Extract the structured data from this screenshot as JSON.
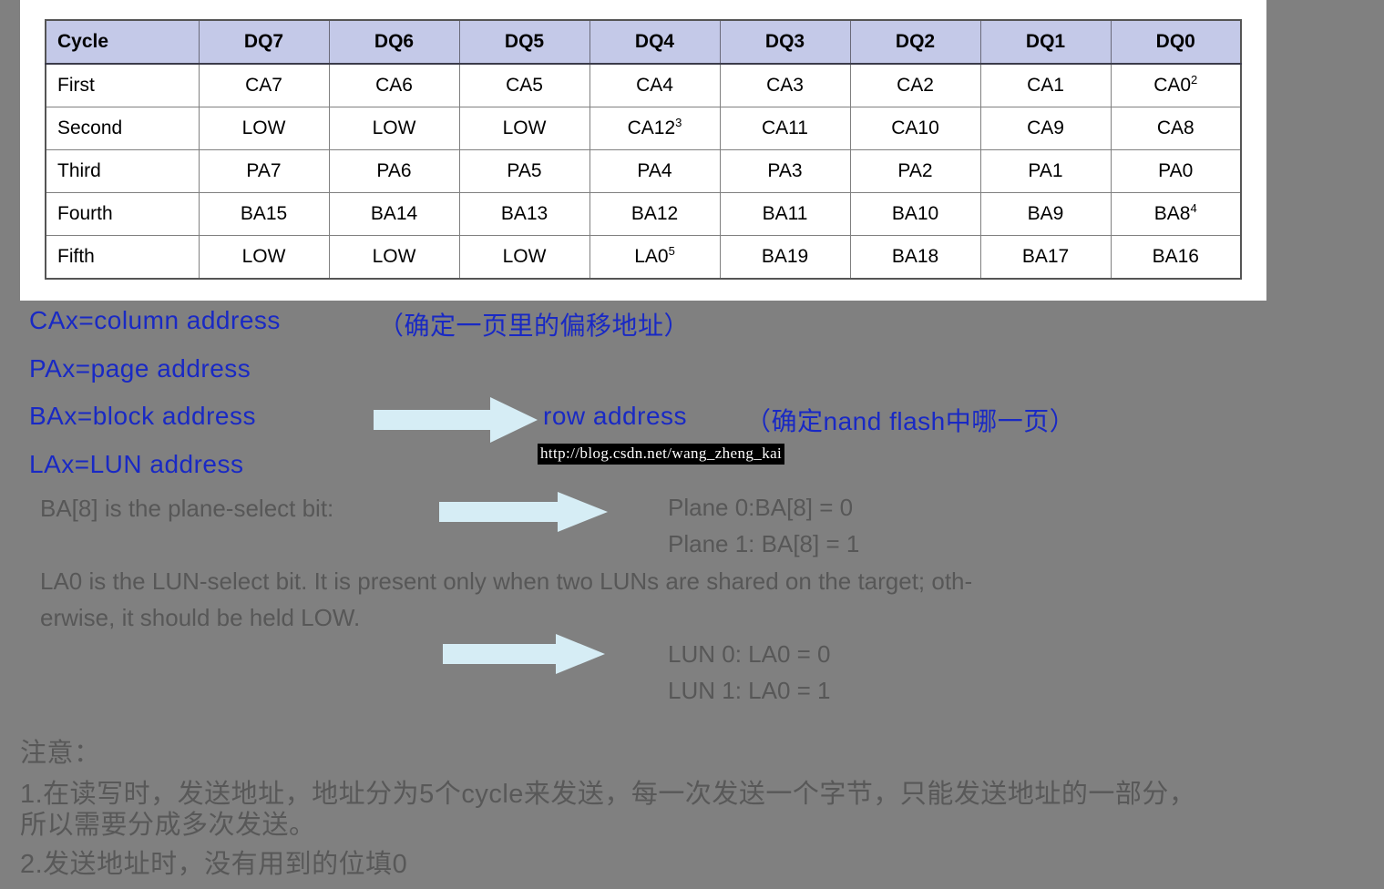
{
  "table": {
    "headers": [
      "Cycle",
      "DQ7",
      "DQ6",
      "DQ5",
      "DQ4",
      "DQ3",
      "DQ2",
      "DQ1",
      "DQ0"
    ],
    "rows": [
      {
        "cycle": "First",
        "cells": [
          {
            "text": "CA7"
          },
          {
            "text": "CA6"
          },
          {
            "text": "CA5"
          },
          {
            "text": "CA4"
          },
          {
            "text": "CA3"
          },
          {
            "text": "CA2"
          },
          {
            "text": "CA1"
          },
          {
            "text": "CA0",
            "sup": "2"
          }
        ]
      },
      {
        "cycle": "Second",
        "cells": [
          {
            "text": "LOW"
          },
          {
            "text": "LOW"
          },
          {
            "text": "LOW"
          },
          {
            "text": "CA12",
            "sup": "3"
          },
          {
            "text": "CA11"
          },
          {
            "text": "CA10"
          },
          {
            "text": "CA9"
          },
          {
            "text": "CA8"
          }
        ]
      },
      {
        "cycle": "Third",
        "cells": [
          {
            "text": "PA7"
          },
          {
            "text": "PA6"
          },
          {
            "text": "PA5"
          },
          {
            "text": "PA4"
          },
          {
            "text": "PA3"
          },
          {
            "text": "PA2"
          },
          {
            "text": "PA1"
          },
          {
            "text": "PA0"
          }
        ]
      },
      {
        "cycle": "Fourth",
        "cells": [
          {
            "text": "BA15"
          },
          {
            "text": "BA14"
          },
          {
            "text": "BA13"
          },
          {
            "text": "BA12"
          },
          {
            "text": "BA11"
          },
          {
            "text": "BA10"
          },
          {
            "text": "BA9"
          },
          {
            "text": "BA8",
            "sup": "4"
          }
        ]
      },
      {
        "cycle": "Fifth",
        "cells": [
          {
            "text": "LOW"
          },
          {
            "text": "LOW"
          },
          {
            "text": "LOW"
          },
          {
            "text": "LA0",
            "sup": "5"
          },
          {
            "text": "BA19"
          },
          {
            "text": "BA18"
          },
          {
            "text": "BA17"
          },
          {
            "text": "BA16"
          }
        ]
      }
    ]
  },
  "legend": {
    "column_address": "CAx=column address",
    "column_address_note": "（确定一页里的偏移地址）",
    "page_address": "PAx=page address",
    "block_address": "BAx=block address",
    "lun_address": "LAx=LUN address",
    "row_address": "row address",
    "row_address_note": "（确定nand flash中哪一页）"
  },
  "watermark": {
    "url": "http://blog.csdn.net/wang_zheng_kai"
  },
  "explanation": {
    "plane_select": "BA[8] is the plane-select bit:",
    "plane_0": "Plane 0:BA[8] = 0",
    "plane_1": "Plane 1: BA[8] = 1",
    "lun_select_line1": "LA0 is the LUN-select bit. It is present only when two LUNs are shared on the target; oth-",
    "lun_select_line2": "erwise, it should be held LOW.",
    "lun_0": "LUN 0: LA0 = 0",
    "lun_1": "LUN 1: LA0 = 1"
  },
  "notes": {
    "title": "注意：",
    "item1_line1": "1.在读写时，发送地址，地址分为5个cycle来发送，每一次发送一个字节，只能发送地址的一部分，",
    "item1_line2": "所以需要分成多次发送。",
    "item2": "2.发送地址时，没有用到的位填0"
  },
  "colors": {
    "background": "#808080",
    "table_header": "#c4c9e8",
    "blue_text": "#1929c4",
    "gray_text": "#575757",
    "arrow": "#d6edf5"
  }
}
